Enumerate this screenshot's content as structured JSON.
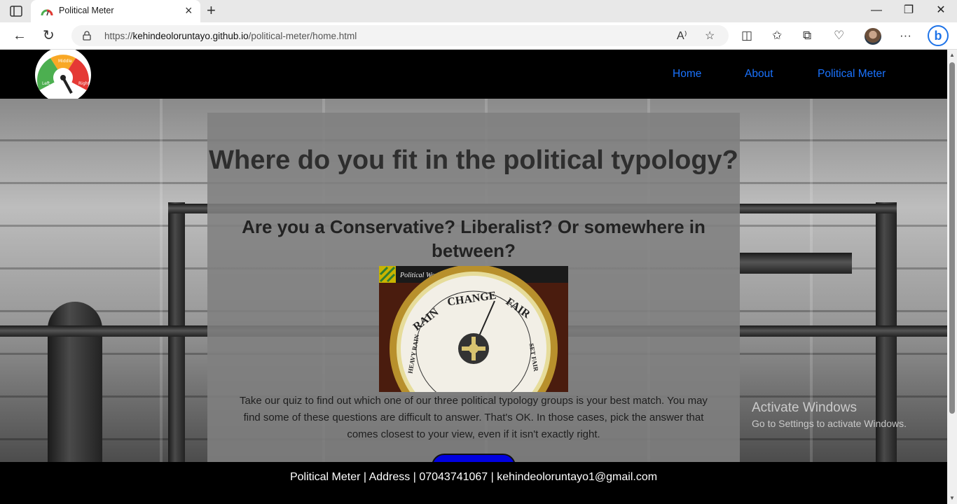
{
  "browser": {
    "tab_title": "Political Meter",
    "url_prefix": "https://",
    "url_host": "kehindeoloruntayo.github.io",
    "url_path": "/political-meter/home.html",
    "read_aloud": "A⁾"
  },
  "site": {
    "nav": [
      "Home",
      "About",
      "Political Meter"
    ],
    "logo_labels": [
      "Left",
      "Middle",
      "Right"
    ]
  },
  "hero": {
    "title": "Where do you fit in the political typology?",
    "subtitle": "Are you a Conservative? Liberalist? Or somewhere in between?",
    "image_caption": "Political Workplace",
    "barometer_words": [
      "RAIN",
      "CHANGE",
      "FAIR",
      "SET FAIR",
      "HEAVY RAIN"
    ],
    "body": "Take our quiz to find out which one of our three political typology groups is your best match. You may find some of these questions are difficult to answer. That's OK. In those cases, pick the answer that comes closest to your view, even if it isn't exactly right."
  },
  "footer": {
    "text": "Political Meter | Address | 07043741067 | kehindeoloruntayo1@gmail.com"
  },
  "watermark": {
    "title": "Activate Windows",
    "subtitle": "Go to Settings to activate Windows."
  },
  "colors": {
    "nav_link": "#1a73ff",
    "start_button": "#0000e0",
    "header_bg": "#000000"
  }
}
